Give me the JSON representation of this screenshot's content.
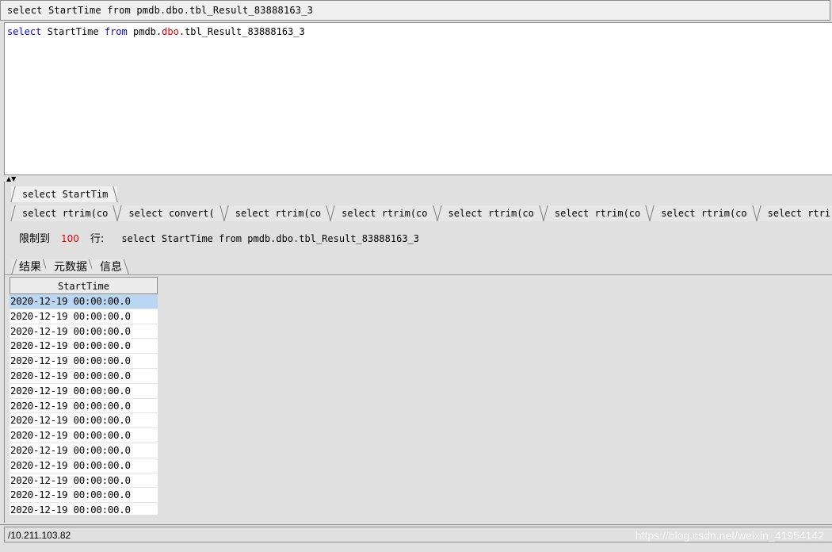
{
  "window": {
    "title": "select StartTime from pmdb.dbo.tbl_Result_83888163_3"
  },
  "editor": {
    "kw_select": "select",
    "col": "StartTime",
    "kw_from": "from",
    "schema_db": "pmdb.",
    "schema_owner": "dbo",
    "table": ".tbl_Result_83888163_3"
  },
  "query_tabs_row1": [
    "select StartTim"
  ],
  "query_tabs_row2": [
    "select rtrim(co",
    "select convert(",
    "select rtrim(co",
    "select rtrim(co",
    "select rtrim(co",
    "select rtrim(co",
    "select rtrim(co",
    "select rtri"
  ],
  "limit": {
    "prefix": "限制到",
    "value": "100",
    "suffix": "行:",
    "sql": "select StartTime from pmdb.dbo.tbl_Result_83888163_3"
  },
  "result_tabs": [
    "结果",
    "元数据",
    "信息"
  ],
  "grid": {
    "column": "StartTime",
    "rows": [
      "2020-12-19 00:00:00.0",
      "2020-12-19 00:00:00.0",
      "2020-12-19 00:00:00.0",
      "2020-12-19 00:00:00.0",
      "2020-12-19 00:00:00.0",
      "2020-12-19 00:00:00.0",
      "2020-12-19 00:00:00.0",
      "2020-12-19 00:00:00.0",
      "2020-12-19 00:00:00.0",
      "2020-12-19 00:00:00.0",
      "2020-12-19 00:00:00.0",
      "2020-12-19 00:00:00.0",
      "2020-12-19 00:00:00.0",
      "2020-12-19 00:00:00.0",
      "2020-12-19 00:00:00.0"
    ]
  },
  "status": {
    "connection": "/10.211.103.82",
    "watermark": "https://blog.csdn.net/weixin_41954142"
  },
  "colors": {
    "keyword": "#0000ff",
    "owner": "#e00000",
    "selected_row": "#b9d7f2"
  }
}
